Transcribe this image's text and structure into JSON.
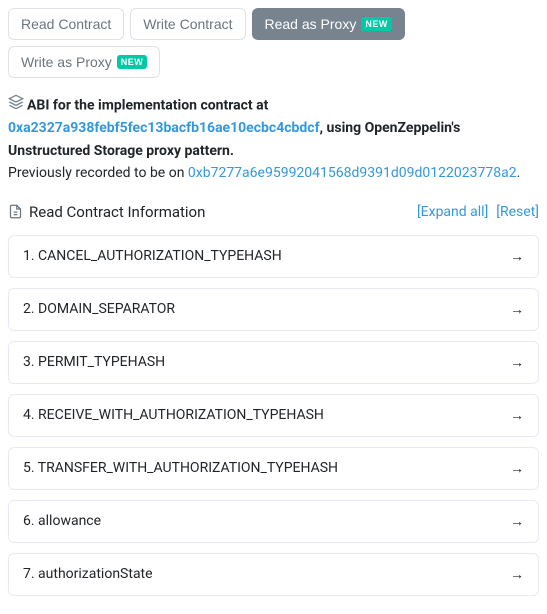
{
  "tabs": [
    {
      "label": "Read Contract",
      "active": false,
      "new": false
    },
    {
      "label": "Write Contract",
      "active": false,
      "new": false
    },
    {
      "label": "Read as Proxy",
      "active": true,
      "new": true
    },
    {
      "label": "Write as Proxy",
      "active": false,
      "new": true
    }
  ],
  "badge_new": "NEW",
  "info": {
    "prefix": "ABI for the implementation contract at ",
    "impl_addr": "0xa2327a938febf5fec13bacfb16ae10ecbc4cbdcf",
    "mid": ", using OpenZeppelin's ",
    "pattern": "Unstructured Storage proxy pattern.",
    "prev_prefix": "Previously recorded to be on ",
    "prev_addr": "0xb7277a6e95992041568d9391d09d0122023778a2",
    "suffix": "."
  },
  "section": {
    "title": "Read Contract Information",
    "expand_all": "[Expand all]",
    "reset": "[Reset]"
  },
  "funcs": [
    {
      "label": "1. CANCEL_AUTHORIZATION_TYPEHASH"
    },
    {
      "label": "2. DOMAIN_SEPARATOR"
    },
    {
      "label": "3. PERMIT_TYPEHASH"
    },
    {
      "label": "4. RECEIVE_WITH_AUTHORIZATION_TYPEHASH"
    },
    {
      "label": "5. TRANSFER_WITH_AUTHORIZATION_TYPEHASH"
    },
    {
      "label": "6. allowance"
    },
    {
      "label": "7. authorizationState"
    }
  ]
}
